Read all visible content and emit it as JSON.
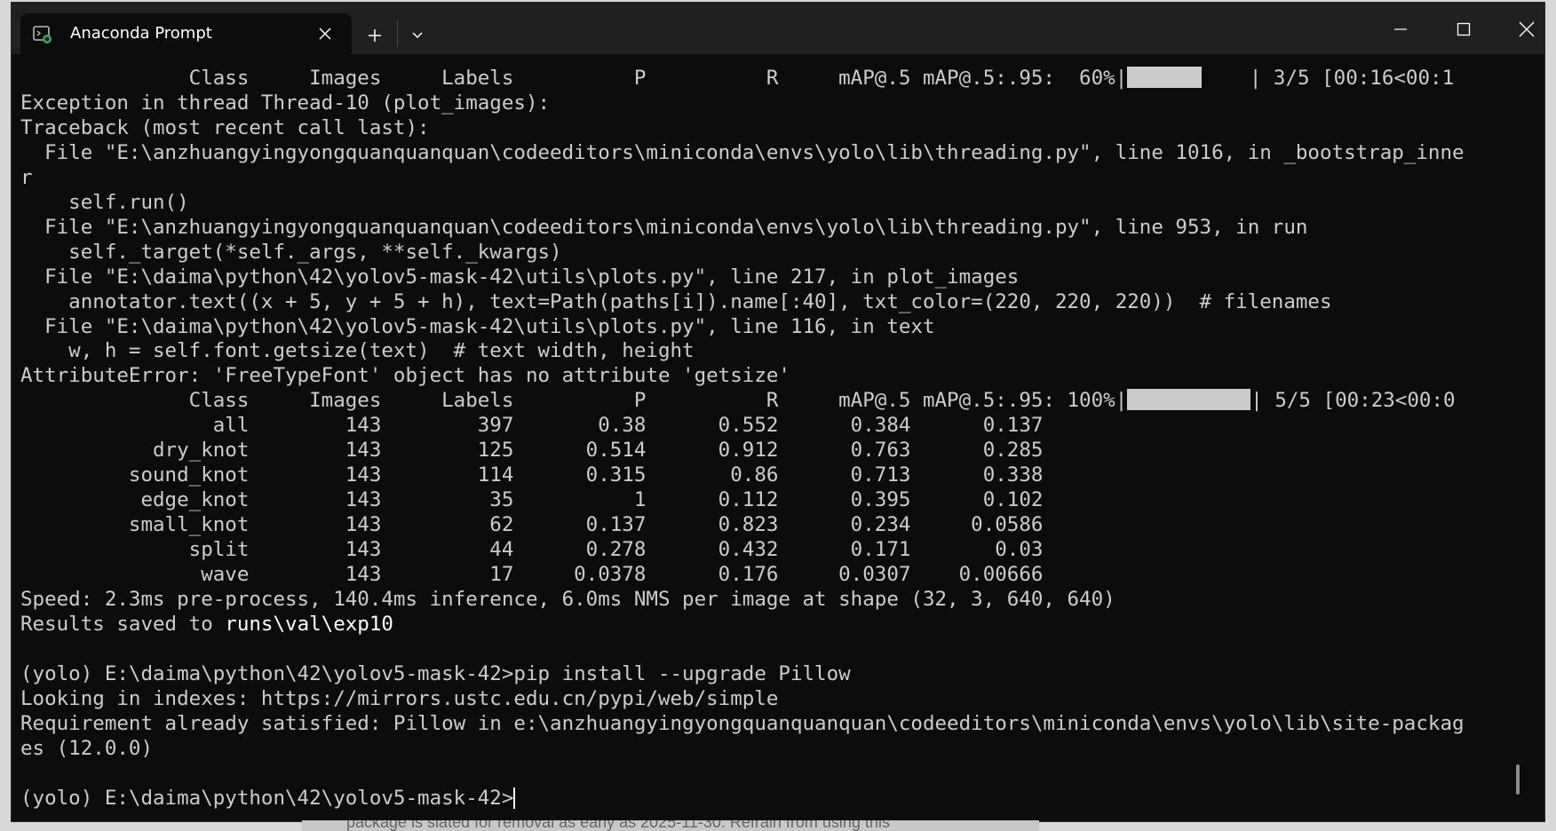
{
  "window": {
    "tab_title": "Anaconda Prompt",
    "icons": {
      "tab": "terminal-icon",
      "tab_close": "close-icon",
      "new_tab": "plus-icon",
      "dropdown": "chevron-down-icon",
      "minimize": "minimize-icon",
      "maximize": "maximize-icon",
      "close": "close-icon"
    }
  },
  "terminal": {
    "lines": [
      "              Class     Images     Labels          P          R     mAP@.5 mAP@.5:.95:  60%|",
      "Exception in thread Thread-10 (plot_images):",
      "Traceback (most recent call last):",
      "  File \"E:\\anzhuangyingyongquanquanquan\\codeeditors\\miniconda\\envs\\yolo\\lib\\threading.py\", line 1016, in _bootstrap_inne",
      "r",
      "    self.run()",
      "  File \"E:\\anzhuangyingyongquanquanquan\\codeeditors\\miniconda\\envs\\yolo\\lib\\threading.py\", line 953, in run",
      "    self._target(*self._args, **self._kwargs)",
      "  File \"E:\\daima\\python\\42\\yolov5-mask-42\\utils\\plots.py\", line 217, in plot_images",
      "    annotator.text((x + 5, y + 5 + h), text=Path(paths[i]).name[:40], txt_color=(220, 220, 220))  # filenames",
      "  File \"E:\\daima\\python\\42\\yolov5-mask-42\\utils\\plots.py\", line 116, in text",
      "    w, h = self.font.getsize(text)  # text width, height",
      "AttributeError: 'FreeTypeFont' object has no attribute 'getsize'",
      "              Class     Images     Labels          P          R     mAP@.5 mAP@.5:.95: 100%|"
    ],
    "progress_60_suffix": "    | 3/5 [00:16<00:1",
    "progress_60_fraction": 0.6,
    "progress_100_suffix": "| 5/5 [00:23<00:0",
    "progress_100_fraction": 1.0,
    "results": [
      "                all        143        397       0.38      0.552      0.384      0.137",
      "           dry_knot        143        125      0.514      0.912      0.763      0.285",
      "         sound_knot        143        114      0.315       0.86      0.713      0.338",
      "          edge_knot        143         35          1      0.112      0.395      0.102",
      "         small_knot        143         62      0.137      0.823      0.234     0.0586",
      "              split        143         44      0.278      0.432      0.171       0.03",
      "               wave        143         17     0.0378      0.176     0.0307    0.00666"
    ],
    "speed_line": "Speed: 2.3ms pre-process, 140.4ms inference, 6.0ms NMS per image at shape (32, 3, 640, 640)",
    "results_saved_prefix": "Results saved to ",
    "results_saved_path": "runs\\val\\exp10",
    "blank": "",
    "pip_lines": [
      "(yolo) E:\\daima\\python\\42\\yolov5-mask-42>pip install --upgrade Pillow",
      "Looking in indexes: https://mirrors.ustc.edu.cn/pypi/web/simple",
      "Requirement already satisfied: Pillow in e:\\anzhuangyingyongquanquanquan\\codeeditors\\miniconda\\envs\\yolo\\lib\\site-packag",
      "es (12.0.0)"
    ],
    "prompt": "(yolo) E:\\daima\\python\\42\\yolov5-mask-42>"
  },
  "background_text": "package is slated for removal as early as 2025-11-30. Refrain from using this"
}
